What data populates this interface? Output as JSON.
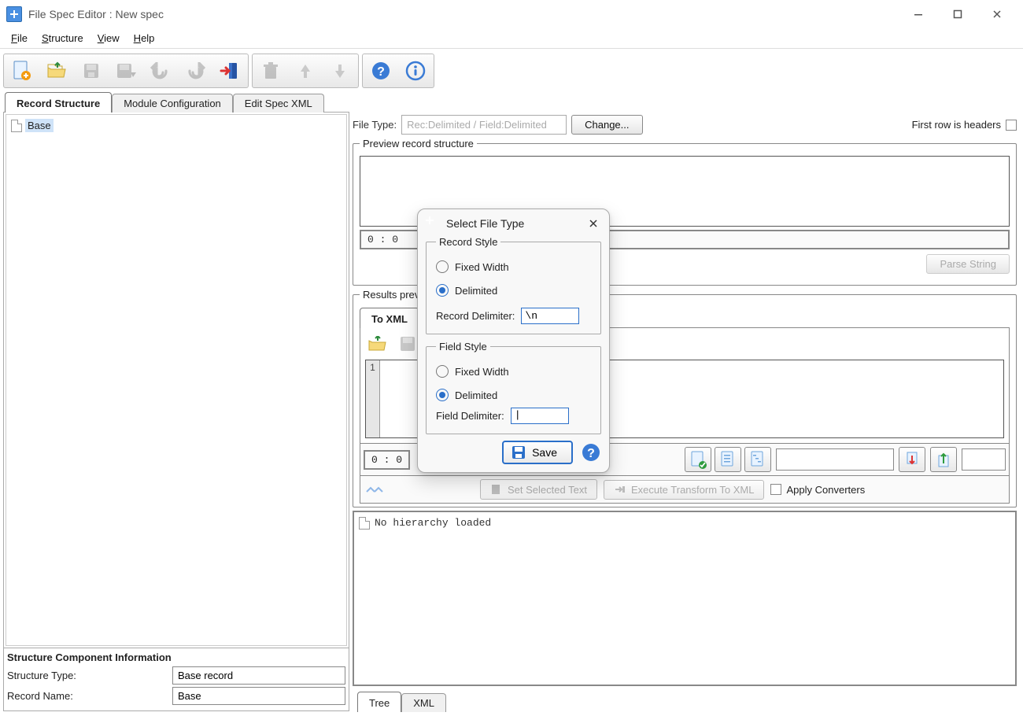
{
  "window": {
    "title": "File Spec Editor : New spec"
  },
  "menus": [
    "File",
    "Structure",
    "View",
    "Help"
  ],
  "tabs": {
    "main": [
      "Record Structure",
      "Module Configuration",
      "Edit Spec XML"
    ],
    "results": [
      "To XML"
    ],
    "bottom": [
      "Tree",
      "XML"
    ]
  },
  "tree": {
    "root": "Base"
  },
  "structure_info": {
    "header": "Structure Component Information",
    "type_label": "Structure Type:",
    "type_value": "Base record",
    "name_label": "Record Name:",
    "name_value": "Base"
  },
  "filetype": {
    "label": "File Type:",
    "value": "Rec:Delimited / Field:Delimited",
    "change_btn": "Change...",
    "first_row_headers": "First row is headers"
  },
  "preview": {
    "legend": "Preview record structure",
    "counter": "0 : 0",
    "parse_btn": "Parse String"
  },
  "results": {
    "legend": "Results preview",
    "counter": "0 : 0",
    "set_selected": "Set Selected Text",
    "execute": "Execute Transform To XML",
    "apply_conv": "Apply Converters",
    "grid_row": "1"
  },
  "hierarchy": {
    "text": "No hierarchy loaded"
  },
  "dialog": {
    "title": "Select File Type",
    "record_style": "Record Style",
    "field_style": "Field Style",
    "fixed_width": "Fixed Width",
    "delimited": "Delimited",
    "record_delim_label": "Record Delimiter:",
    "record_delim_value": "\\n",
    "field_delim_label": "Field Delimiter:",
    "field_delim_value": "|",
    "save": "Save"
  }
}
